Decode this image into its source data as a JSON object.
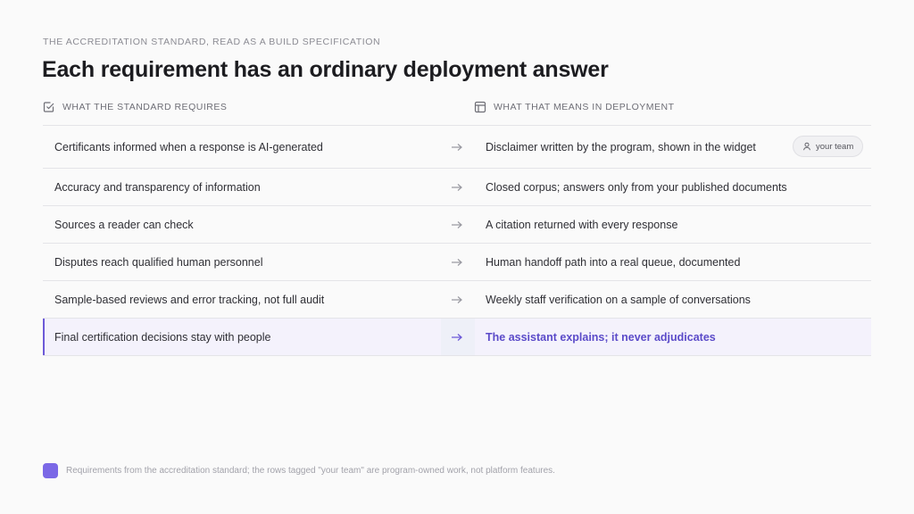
{
  "eyebrow": "THE ACCREDITATION STANDARD, READ AS A BUILD SPECIFICATION",
  "title": "Each requirement has an ordinary deployment answer",
  "columns": {
    "left": {
      "label": "WHAT THE STANDARD REQUIRES",
      "icon": "checkbox-icon"
    },
    "right": {
      "label": "WHAT THAT MEANS IN DEPLOYMENT",
      "icon": "layout-icon"
    }
  },
  "rows": [
    {
      "requirement": "Certificants informed when a response is AI-generated",
      "answer": "Disclaimer written by the program, shown in the widget",
      "tag": "your team"
    },
    {
      "requirement": "Accuracy and transparency of information",
      "answer": "Closed corpus; answers only from your published documents"
    },
    {
      "requirement": "Sources a reader can check",
      "answer": "A citation returned with every response"
    },
    {
      "requirement": "Disputes reach qualified human personnel",
      "answer": "Human handoff path into a real queue, documented"
    },
    {
      "requirement": "Sample-based reviews and error tracking, not full audit",
      "answer": "Weekly staff verification on a sample of conversations"
    },
    {
      "requirement": "Final certification decisions stay with people",
      "answer": "The assistant explains; it never adjudicates"
    }
  ],
  "footer": "Requirements from the accreditation standard; the rows tagged \"your team\" are program-owned work, not platform features.",
  "colors": {
    "accent": "#6d5ad8",
    "highlight_bg": "#f4f2fc",
    "swatch": "#7b68e6"
  }
}
